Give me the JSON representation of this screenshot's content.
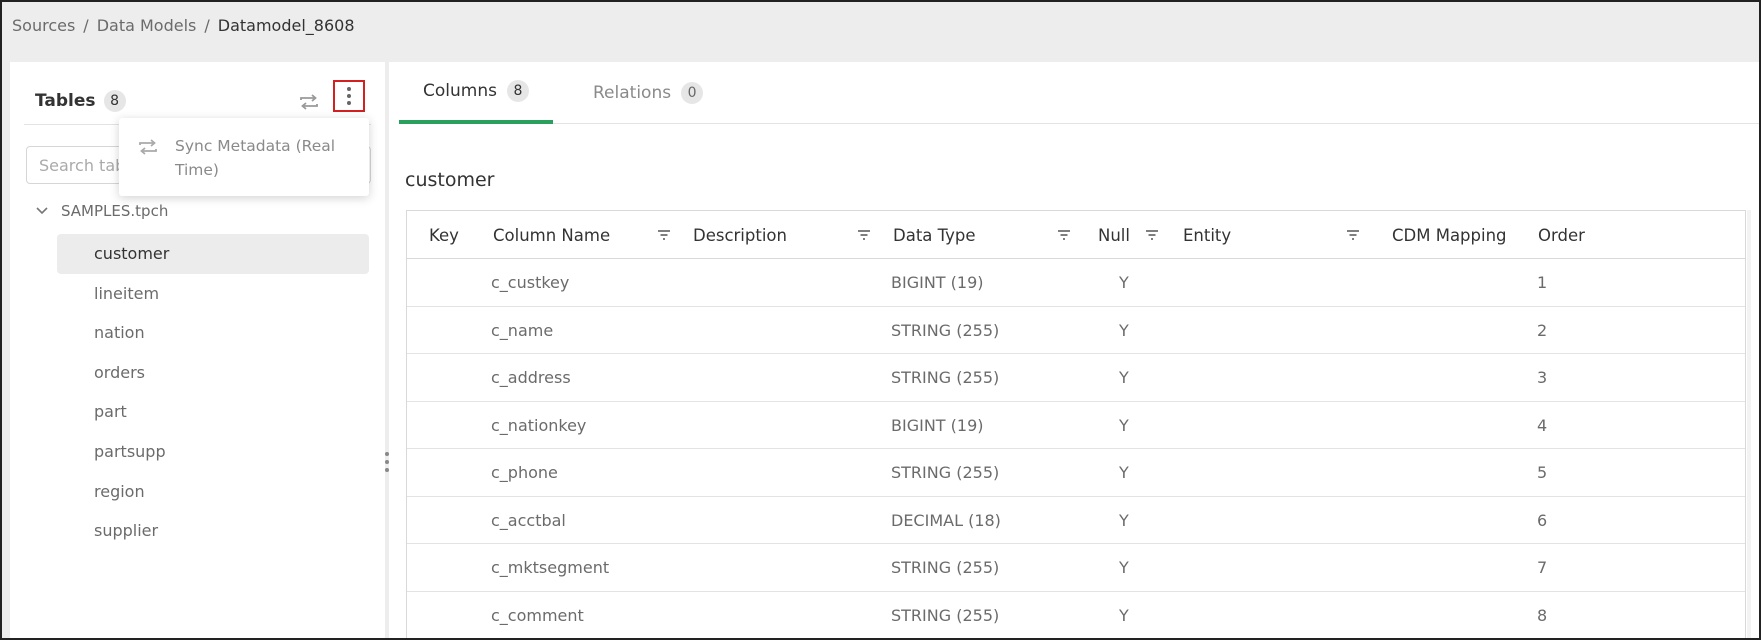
{
  "breadcrumb": {
    "items": [
      "Sources",
      "Data Models"
    ],
    "separator": "/",
    "current": "Datamodel_8608"
  },
  "tables_panel": {
    "title": "Tables",
    "count": "8",
    "search_placeholder": "Search tables",
    "schema": "SAMPLES.tpch",
    "items": [
      "customer",
      "lineitem",
      "nation",
      "orders",
      "part",
      "partsupp",
      "region",
      "supplier"
    ],
    "selected": "customer"
  },
  "menu": {
    "sync_metadata_label": "Sync Metadata (Real Time)"
  },
  "tabs": [
    {
      "label": "Columns",
      "count": "8",
      "active": true
    },
    {
      "label": "Relations",
      "count": "0",
      "active": false
    }
  ],
  "table": {
    "title": "customer",
    "headers": {
      "key": "Key",
      "column_name": "Column Name",
      "description": "Description",
      "data_type": "Data Type",
      "null": "Null",
      "entity": "Entity",
      "cdm_mapping": "CDM Mapping",
      "order": "Order"
    },
    "rows": [
      {
        "key": "",
        "column_name": "c_custkey",
        "description": "",
        "data_type": "BIGINT (19)",
        "null": "Y",
        "entity": "",
        "cdm_mapping": "",
        "order": "1"
      },
      {
        "key": "",
        "column_name": "c_name",
        "description": "",
        "data_type": "STRING (255)",
        "null": "Y",
        "entity": "",
        "cdm_mapping": "",
        "order": "2"
      },
      {
        "key": "",
        "column_name": "c_address",
        "description": "",
        "data_type": "STRING (255)",
        "null": "Y",
        "entity": "",
        "cdm_mapping": "",
        "order": "3"
      },
      {
        "key": "",
        "column_name": "c_nationkey",
        "description": "",
        "data_type": "BIGINT (19)",
        "null": "Y",
        "entity": "",
        "cdm_mapping": "",
        "order": "4"
      },
      {
        "key": "",
        "column_name": "c_phone",
        "description": "",
        "data_type": "STRING (255)",
        "null": "Y",
        "entity": "",
        "cdm_mapping": "",
        "order": "5"
      },
      {
        "key": "",
        "column_name": "c_acctbal",
        "description": "",
        "data_type": "DECIMAL (18)",
        "null": "Y",
        "entity": "",
        "cdm_mapping": "",
        "order": "6"
      },
      {
        "key": "",
        "column_name": "c_mktsegment",
        "description": "",
        "data_type": "STRING (255)",
        "null": "Y",
        "entity": "",
        "cdm_mapping": "",
        "order": "7"
      },
      {
        "key": "",
        "column_name": "c_comment",
        "description": "",
        "data_type": "STRING (255)",
        "null": "Y",
        "entity": "",
        "cdm_mapping": "",
        "order": "8"
      }
    ]
  },
  "colors": {
    "accent": "#2aa05e",
    "highlight_border": "#d32020"
  }
}
